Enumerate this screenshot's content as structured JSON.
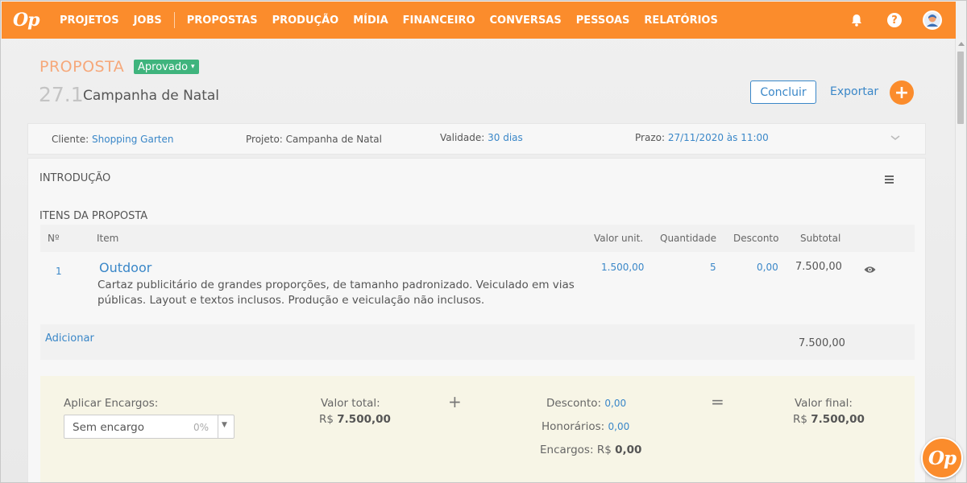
{
  "app": {
    "logo": "Op",
    "float_logo": "Op"
  },
  "nav": {
    "items_left": [
      "PROJETOS",
      "JOBS"
    ],
    "items_right": [
      "PROPOSTAS",
      "PRODUÇÃO",
      "MÍDIA",
      "FINANCEIRO",
      "CONVERSAS",
      "PESSOAS",
      "RELATÓRIOS"
    ],
    "help_label": "?"
  },
  "header": {
    "section": "PROPOSTA",
    "status": "Aprovado",
    "number": "27.1",
    "name": "Campanha de Natal",
    "concluir_label": "Concluir",
    "exportar_label": "Exportar",
    "add_label": "+"
  },
  "info": {
    "cliente_label": "Cliente:",
    "cliente_value": "Shopping Garten",
    "projeto_label": "Projeto:",
    "projeto_value": "Campanha de Natal",
    "validade_label": "Validade:",
    "validade_value": "30 dias",
    "prazo_label": "Prazo:",
    "prazo_value": "27/11/2020 às 11:00"
  },
  "sections": {
    "intro": "INTRODUÇÃO",
    "items": "ITENS DA PROPOSTA"
  },
  "table": {
    "headers": {
      "num": "Nº",
      "item": "Item",
      "valor_unit": "Valor unit.",
      "quantidade": "Quantidade",
      "desconto": "Desconto",
      "subtotal": "Subtotal"
    },
    "rows": [
      {
        "num": "1",
        "title": "Outdoor",
        "description": "Cartaz publicitário de grandes proporções, de tamanho padronizado. Veiculado em vias públicas. Layout e textos inclusos. Produção e veiculação não inclusos.",
        "valor_unit": "1.500,00",
        "quantidade": "5",
        "desconto": "0,00",
        "subtotal": "7.500,00"
      }
    ],
    "add_label": "Adicionar",
    "total": "7.500,00"
  },
  "summary": {
    "encargos_label": "Aplicar Encargos:",
    "encargo_selected": "Sem encargo",
    "encargo_pct": "0%",
    "valor_total_label": "Valor total:",
    "valor_total_currency": "R$",
    "valor_total": "7.500,00",
    "plus": "+",
    "desconto_label": "Desconto:",
    "desconto_value": "0,00",
    "honorarios_label": "Honorários:",
    "honorarios_value": "0,00",
    "encargos_sum_label": "Encargos:",
    "encargos_currency": "R$",
    "encargos_value": "0,00",
    "equals": "=",
    "valor_final_label": "Valor final:",
    "valor_final_currency": "R$",
    "valor_final": "7.500,00"
  },
  "colors": {
    "brand_orange": "#fb8c2c",
    "link_blue": "#3a87c8",
    "status_green": "#3fb47d",
    "summary_bg": "#f7f5e6"
  },
  "icons": [
    "bell-icon",
    "help-icon",
    "avatar",
    "menu-icon",
    "eye-icon",
    "chevron-down-icon",
    "plus-icon"
  ]
}
